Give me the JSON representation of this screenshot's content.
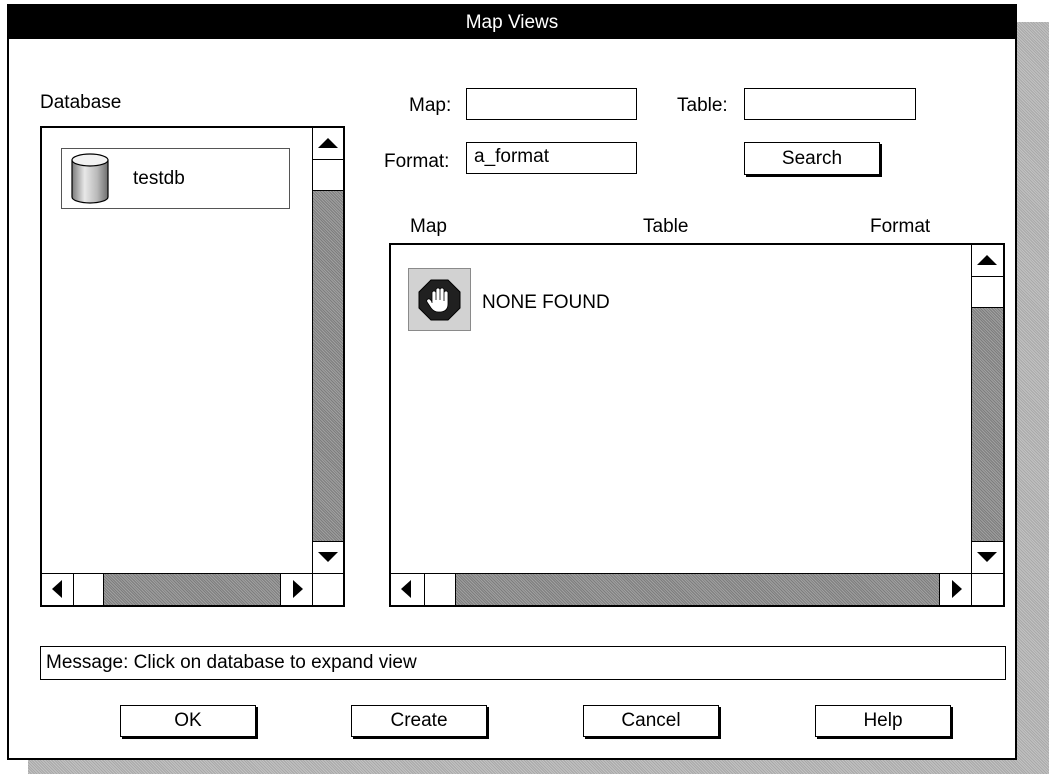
{
  "window": {
    "title": "Map Views"
  },
  "database": {
    "label": "Database",
    "items": [
      {
        "name": "testdb",
        "icon": "database-cylinder-icon"
      }
    ]
  },
  "filters": {
    "map_label": "Map:",
    "map_value": "",
    "table_label": "Table:",
    "table_value": "",
    "format_label": "Format:",
    "format_value": "a_format",
    "search_label": "Search"
  },
  "results": {
    "columns": [
      "Map",
      "Table",
      "Format"
    ],
    "status_icon": "stop-hand-icon",
    "status_text": "NONE FOUND"
  },
  "message": {
    "text": "Message:  Click on database to expand view"
  },
  "buttons": {
    "ok": "OK",
    "create": "Create",
    "cancel": "Cancel",
    "help": "Help"
  }
}
